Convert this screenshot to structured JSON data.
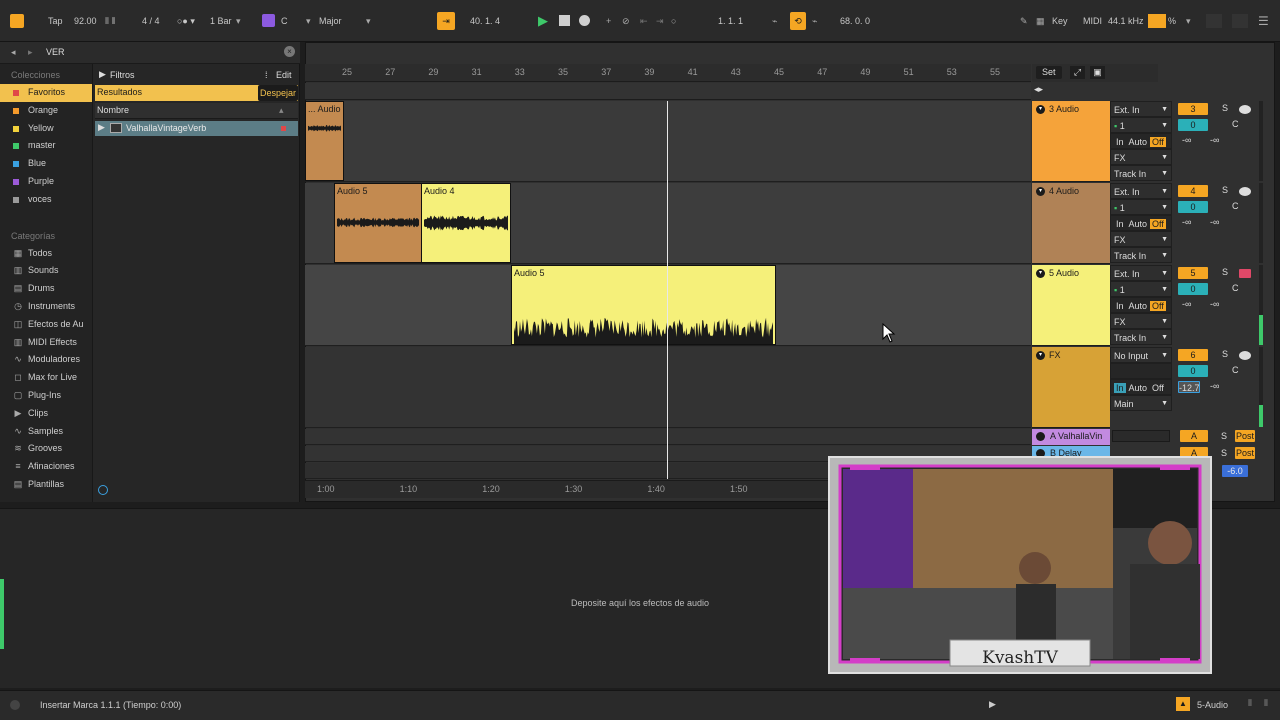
{
  "topbar": {
    "tap_label": "Tap",
    "tempo": "92.00",
    "time_signature": "4 / 4",
    "quantize": "1 Bar",
    "key": "C",
    "scale": "Major",
    "arrangement_position": "40.  1.  4",
    "loop_start": "1.  1.  1",
    "loop_length": "68.  0.  0",
    "key_label": "Key",
    "midi_label": "MIDI",
    "sample_rate": "44.1 kHz",
    "cpu_label": "%"
  },
  "browser": {
    "search_value": "VER",
    "collections_header": "Colecciones",
    "collections": [
      {
        "label": "Favoritos",
        "color": "#e04848",
        "selected": true
      },
      {
        "label": "Orange",
        "color": "#f59a2b"
      },
      {
        "label": "Yellow",
        "color": "#f2d23c"
      },
      {
        "label": "master",
        "color": "#3ec96a"
      },
      {
        "label": "Blue",
        "color": "#3aa0e0"
      },
      {
        "label": "Purple",
        "color": "#9c5ad8"
      },
      {
        "label": "voces",
        "color": "#9a9a9a"
      }
    ],
    "categories_header": "Categorías",
    "categories": [
      {
        "label": "Todos",
        "icon": "grid-icon"
      },
      {
        "label": "Sounds",
        "icon": "sounds-icon"
      },
      {
        "label": "Drums",
        "icon": "drums-icon"
      },
      {
        "label": "Instruments",
        "icon": "instruments-icon"
      },
      {
        "label": "Efectos de Au",
        "icon": "audio-fx-icon"
      },
      {
        "label": "MIDI Effects",
        "icon": "midi-fx-icon"
      },
      {
        "label": "Moduladores",
        "icon": "modulators-icon"
      },
      {
        "label": "Max for Live",
        "icon": "max-icon"
      },
      {
        "label": "Plug-Ins",
        "icon": "plugins-icon"
      },
      {
        "label": "Clips",
        "icon": "clips-icon"
      },
      {
        "label": "Samples",
        "icon": "samples-icon"
      },
      {
        "label": "Grooves",
        "icon": "grooves-icon"
      },
      {
        "label": "Afinaciones",
        "icon": "tunings-icon"
      },
      {
        "label": "Plantillas",
        "icon": "templates-icon"
      }
    ],
    "filters_label": "Filtros",
    "edit_label": "Edit",
    "results_label": "Resultados",
    "clear_label": "Despejar",
    "name_column": "Nombre",
    "results": [
      "ValhallaVintageVerb"
    ]
  },
  "arrangement": {
    "ruler_bars": [
      "25",
      "27",
      "29",
      "31",
      "33",
      "35",
      "37",
      "39",
      "41",
      "43",
      "45",
      "47",
      "49",
      "51",
      "53",
      "55"
    ],
    "time_labels": [
      "1:00",
      "1:10",
      "1:20",
      "1:30",
      "1:40",
      "1:50"
    ],
    "set_label": "Set",
    "clips": [
      {
        "label": "... Audio",
        "track": 0,
        "color": "#c38a50"
      },
      {
        "label": "Audio 5",
        "track": 1,
        "color": "#c38a50"
      },
      {
        "label": "Audio 4",
        "track": 1,
        "color": "#f5f07a"
      },
      {
        "label": "Audio 5",
        "track": 2,
        "color": "#f5f07a"
      }
    ]
  },
  "tracks": [
    {
      "name": "3 Audio",
      "color": "#f5a33a",
      "input": "Ext. In",
      "channel": "1",
      "monitor_in": "In",
      "monitor_auto": "Auto",
      "monitor_off": "Off",
      "fx": "FX",
      "track_in": "Track In",
      "number": "3",
      "vol": "0",
      "pan": "C",
      "inf1": "-∞",
      "inf2": "-∞",
      "solo": "S"
    },
    {
      "name": "4 Audio",
      "color": "#b08256",
      "input": "Ext. In",
      "channel": "1",
      "monitor_in": "In",
      "monitor_auto": "Auto",
      "monitor_off": "Off",
      "fx": "FX",
      "track_in": "Track In",
      "number": "4",
      "vol": "0",
      "pan": "C",
      "inf1": "-∞",
      "inf2": "-∞",
      "solo": "S"
    },
    {
      "name": "5 Audio",
      "color": "#f5f07a",
      "input": "Ext. In",
      "channel": "1",
      "monitor_in": "In",
      "monitor_auto": "Auto",
      "monitor_off": "Off",
      "fx": "FX",
      "track_in": "Track In",
      "number": "5",
      "vol": "0",
      "pan": "C",
      "inf1": "-∞",
      "inf2": "-∞",
      "solo": "S"
    },
    {
      "name": "FX",
      "color": "#d7a236",
      "input": "No Input",
      "monitor_in": "In",
      "monitor_auto": "Auto",
      "monitor_off": "Off",
      "output": "Main",
      "number": "6",
      "vol": "0",
      "pan": "C",
      "vol_db": "-12.7",
      "inf1": "-∞",
      "solo": "S"
    }
  ],
  "returns": [
    {
      "name": "A ValhallaVin",
      "letter": "A",
      "solo": "S",
      "post": "Post"
    },
    {
      "name": "B Delay",
      "letter": "A",
      "solo": "S",
      "post": "Post"
    }
  ],
  "master_value": "-6.0",
  "device_drop_text": "Deposite aquí los efectos de audio",
  "status": {
    "message": "Insertar Marca 1.1.1 (Tiempo: 0:00)",
    "selected_track": "5-Audio"
  },
  "webcam": {
    "caption": "KvashTV"
  }
}
